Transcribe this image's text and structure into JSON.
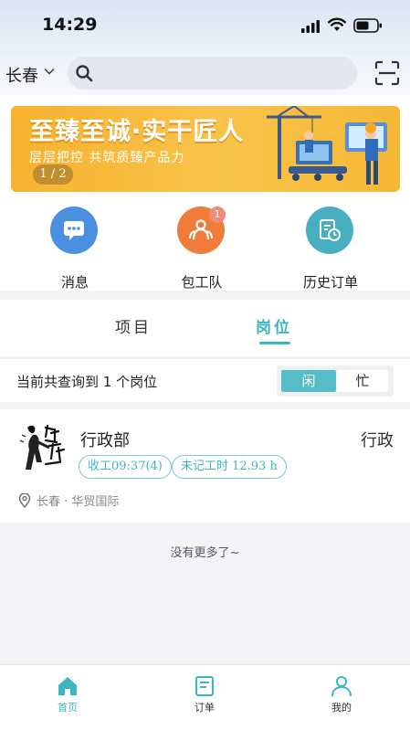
{
  "status_bar": {
    "time": "14:29"
  },
  "header": {
    "city": "长春"
  },
  "banner": {
    "title": "至臻至诚·实干匠人",
    "subtitle": "层层把控 共筑质臻产品力",
    "pager": "1 / 2"
  },
  "quick_actions": [
    {
      "label": "消息",
      "icon": "message-icon",
      "color": "#4a8fe0"
    },
    {
      "label": "包工队",
      "icon": "team-icon",
      "color": "#f07c3a",
      "badge": "1"
    },
    {
      "label": "历史订单",
      "icon": "history-order-icon",
      "color": "#48afc0"
    }
  ],
  "tabs": {
    "project": "项目",
    "position": "岗位",
    "active": "position"
  },
  "filter": {
    "summary": "当前共查询到 1 个岗位",
    "toggle_idle": "闲",
    "toggle_busy": "忙",
    "selected": "idle"
  },
  "results": [
    {
      "department": "行政部",
      "role": "行政",
      "chip_clock_out": "收工09:37(4)",
      "chip_unrecorded": "未记工时 12.93 h",
      "location": "长春 · 华贸国际"
    }
  ],
  "list_footer": "没有更多了~",
  "bottom_nav": [
    {
      "label": "首页",
      "icon": "home-icon",
      "active": true
    },
    {
      "label": "订单",
      "icon": "order-icon",
      "active": false
    },
    {
      "label": "我的",
      "icon": "profile-icon",
      "active": false
    }
  ],
  "colors": {
    "accent": "#3bb7c4",
    "banner": "#f6b22f"
  }
}
